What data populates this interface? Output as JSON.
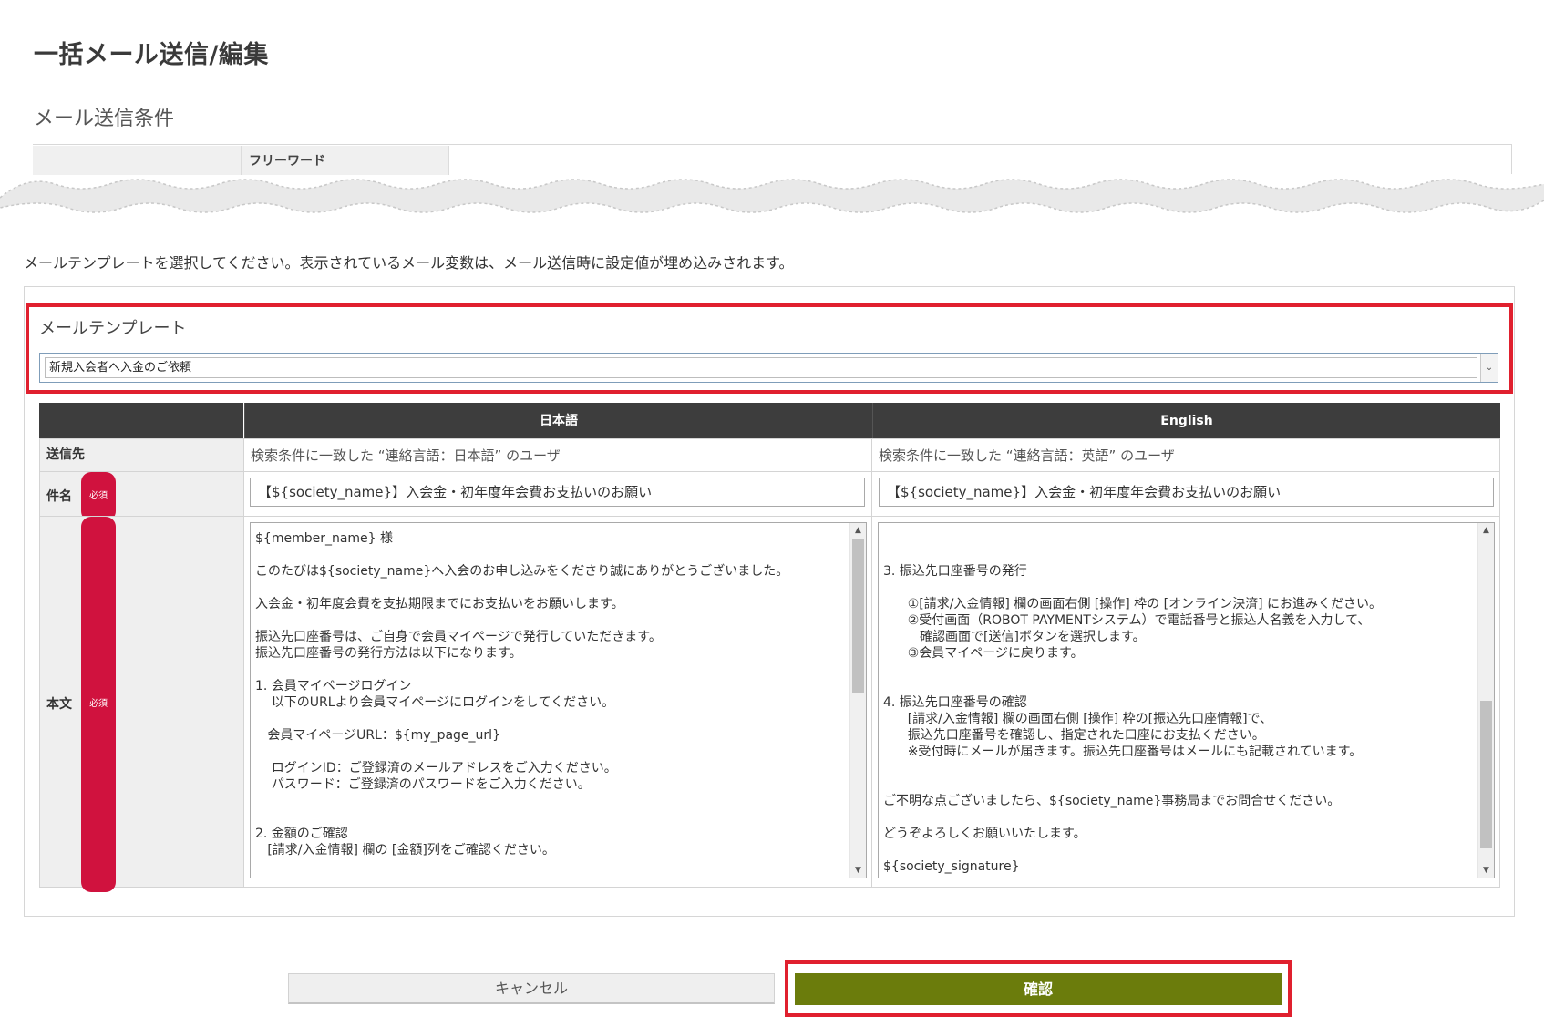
{
  "page": {
    "title": "一括メール送信/編集"
  },
  "conditions": {
    "section_title": "メール送信条件",
    "free_word_label": "フリーワード"
  },
  "instruction": "メールテンプレートを選択してください。表示されているメール変数は、メール送信時に設定値が埋め込みされます。",
  "template": {
    "label": "メールテンプレート",
    "selected": "新規入会者へ入金のご依頼"
  },
  "grid": {
    "col_ja": "日本語",
    "col_en": "English",
    "row_recipient": "送信先",
    "row_subject": "件名",
    "row_body": "本文",
    "required_badge": "必須",
    "recipient_ja": "検索条件に一致した “連絡言語：日本語” のユーザ",
    "recipient_en": "検索条件に一致した “連絡言語：英語” のユーザ",
    "subject_ja": "【${society_name}】入会金・初年度年会費お支払いのお願い",
    "subject_en": "【${society_name}】入会金・初年度年会費お支払いのお願い",
    "body_ja": "${member_name} 様\n\nこのたびは${society_name}へ入会のお申し込みをくださり誠にありがとうございました。\n\n入会金・初年度会費を支払期限までにお支払いをお願いします。\n\n振込先口座番号は、ご自身で会員マイページで発行していただきます。\n振込先口座番号の発行方法は以下になります。\n\n1. 会員マイページログイン\n    以下のURLより会員マイページにログインをしてください。\n\n   会員マイページURL：${my_page_url}\n\n    ログインID：ご登録済のメールアドレスをご入力ください。\n    パスワード：ご登録済のパスワードをご入力ください。\n\n\n2. 金額のご確認\n   [請求/入金情報] 欄の [金額]列をご確認ください。",
    "body_en": "\n\n3. 振込先口座番号の発行\n\n      ①[請求/入金情報] 欄の画面右側 [操作] 枠の [オンライン決済] にお進みください。\n      ②受付画面（ROBOT PAYMENTシステム）で電話番号と振込人名義を入力して、\n         確認画面で[送信]ボタンを選択します。\n      ③会員マイページに戻ります。\n\n\n4. 振込先口座番号の確認\n      [請求/入金情報] 欄の画面右側 [操作] 枠の[振込先口座情報]で、\n      振込先口座番号を確認し、指定された口座にお支払ください。\n      ※受付時にメールが届きます。振込先口座番号はメールにも記載されています。\n\n\nご不明な点ございましたら、${society_name}事務局までお問合せください。\n\nどうぞよろしくお願いいたします。\n\n${society_signature}"
  },
  "buttons": {
    "cancel": "キャンセル",
    "confirm": "確認"
  },
  "icons": {
    "dropdown": "chevron-down-icon",
    "scroll_up": "scroll-up-icon",
    "scroll_down": "scroll-down-icon"
  },
  "colors": {
    "highlight": "#e0202e",
    "confirm_button": "#6b7c0c",
    "header": "#3d3d3d",
    "badge": "#d0123e"
  }
}
